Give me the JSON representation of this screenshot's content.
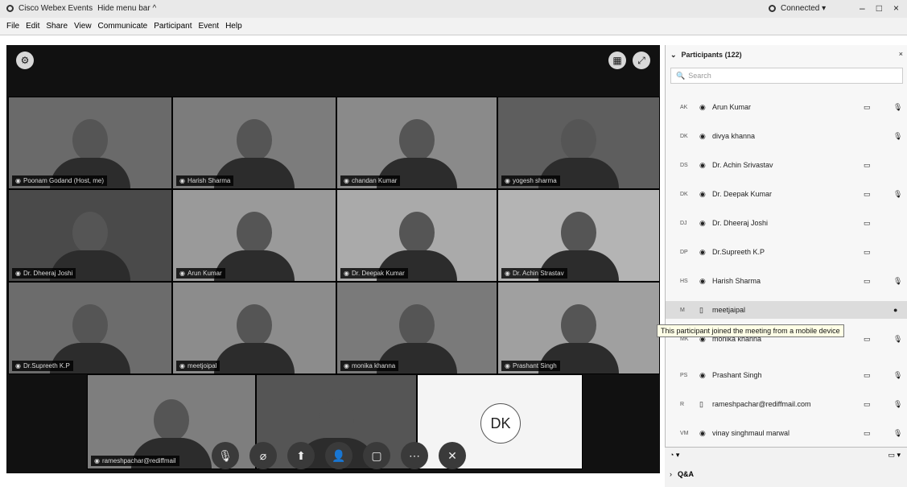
{
  "window": {
    "app_title": "Cisco Webex Events",
    "hide_menu": "Hide menu bar ^",
    "status": "Connected ▾",
    "min": "–",
    "max": "□",
    "close": "×"
  },
  "menu": [
    "File",
    "Edit",
    "Share",
    "View",
    "Communicate",
    "Participant",
    "Event",
    "Help"
  ],
  "tiles": [
    {
      "name": "Poonam Godand (Host, me)"
    },
    {
      "name": "Harish Sharma"
    },
    {
      "name": "chandan Kumar"
    },
    {
      "name": "yogesh sharma"
    },
    {
      "name": "Dr. Dheeraj Joshi"
    },
    {
      "name": "Arun Kumar"
    },
    {
      "name": "Dr. Deepak Kumar"
    },
    {
      "name": "Dr. Achin Strastav"
    },
    {
      "name": "Dr.Supreeth K.P"
    },
    {
      "name": "meetjoipal"
    },
    {
      "name": "monika khanna"
    },
    {
      "name": "Prashant Singh"
    },
    {
      "name": "rameshpachar@rediffmail"
    },
    {
      "name": ""
    }
  ],
  "dk_avatar": "DK",
  "controls": [
    "mute-icon",
    "video-icon",
    "share-icon",
    "participants-icon",
    "chat-icon",
    "more-icon",
    "leave-icon"
  ],
  "participants": {
    "title": "Participants (122)",
    "search_placeholder": "Search",
    "rows": [
      {
        "initials": "AK",
        "name": "Arun Kumar",
        "cam": "▭",
        "mic": "🎙"
      },
      {
        "initials": "DK",
        "name": "divya khanna",
        "cam": "",
        "mic": "🎙"
      },
      {
        "initials": "DS",
        "name": "Dr. Achin Srivastav",
        "cam": "▭",
        "mic": ""
      },
      {
        "initials": "DK",
        "name": "Dr. Deepak Kumar",
        "cam": "▭",
        "mic": "🎙"
      },
      {
        "initials": "DJ",
        "name": "Dr. Dheeraj Joshi",
        "cam": "▭",
        "mic": ""
      },
      {
        "initials": "DP",
        "name": "Dr.Supreeth K.P",
        "cam": "▭",
        "mic": ""
      },
      {
        "initials": "HS",
        "name": "Harish Sharma",
        "cam": "▭",
        "mic": "🎙"
      },
      {
        "initials": "M",
        "name": "meetjaipal",
        "cam": "",
        "mic": "●"
      },
      {
        "initials": "MK",
        "name": "monika khanna",
        "cam": "▭",
        "mic": "🎙"
      },
      {
        "initials": "PS",
        "name": "Prashant Singh",
        "cam": "▭",
        "mic": "🎙"
      },
      {
        "initials": "R",
        "name": "rameshpachar@rediffmail.com",
        "cam": "▭",
        "mic": "🎙"
      },
      {
        "initials": "VM",
        "name": "vinay singhmaul marwal",
        "cam": "▭",
        "mic": "🎙"
      }
    ],
    "tooltip": "This participant joined the meeting from a mobile device",
    "qa": "Q&A"
  }
}
